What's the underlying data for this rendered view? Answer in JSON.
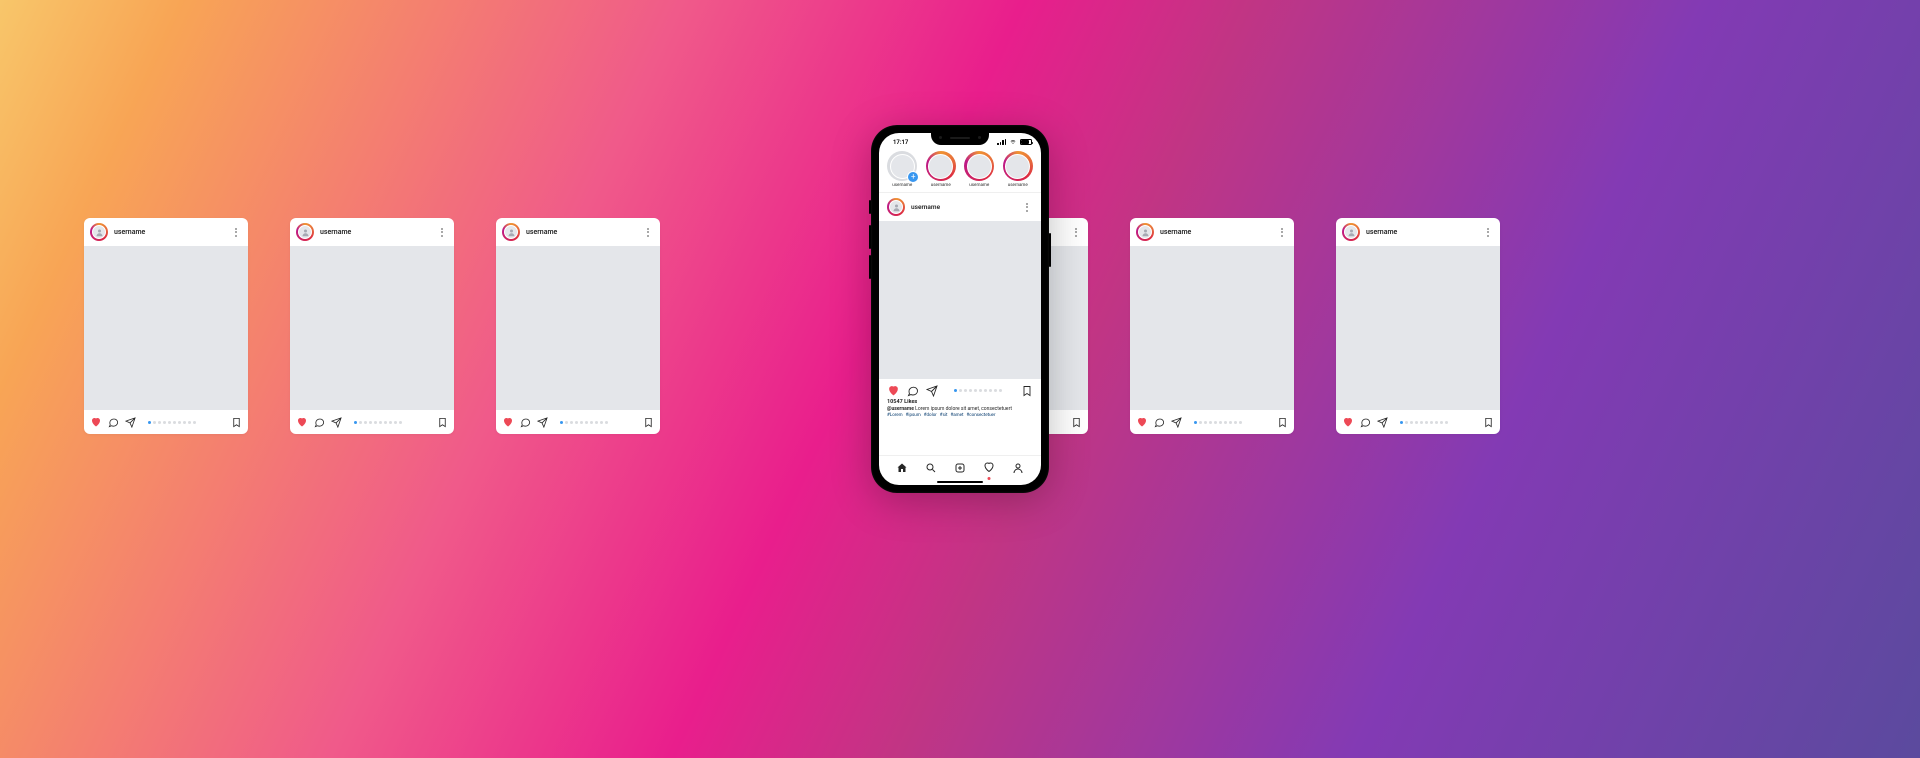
{
  "post_username": "username",
  "phone": {
    "time": "17:17",
    "stories": [
      {
        "label": "username",
        "own": true
      },
      {
        "label": "username"
      },
      {
        "label": "username"
      },
      {
        "label": "username"
      }
    ],
    "post": {
      "username": "username",
      "likes": "10547 Likes",
      "caption_user": "@username",
      "caption_text": "Lorem ipsum dolore sit amet, consectetuert",
      "hashtags": [
        "#Lorem",
        "#ipsum",
        "#dolor",
        "#sit",
        "#amet",
        "#consectetuer"
      ]
    }
  },
  "carousel_dots": 10,
  "phone_dots": 10
}
